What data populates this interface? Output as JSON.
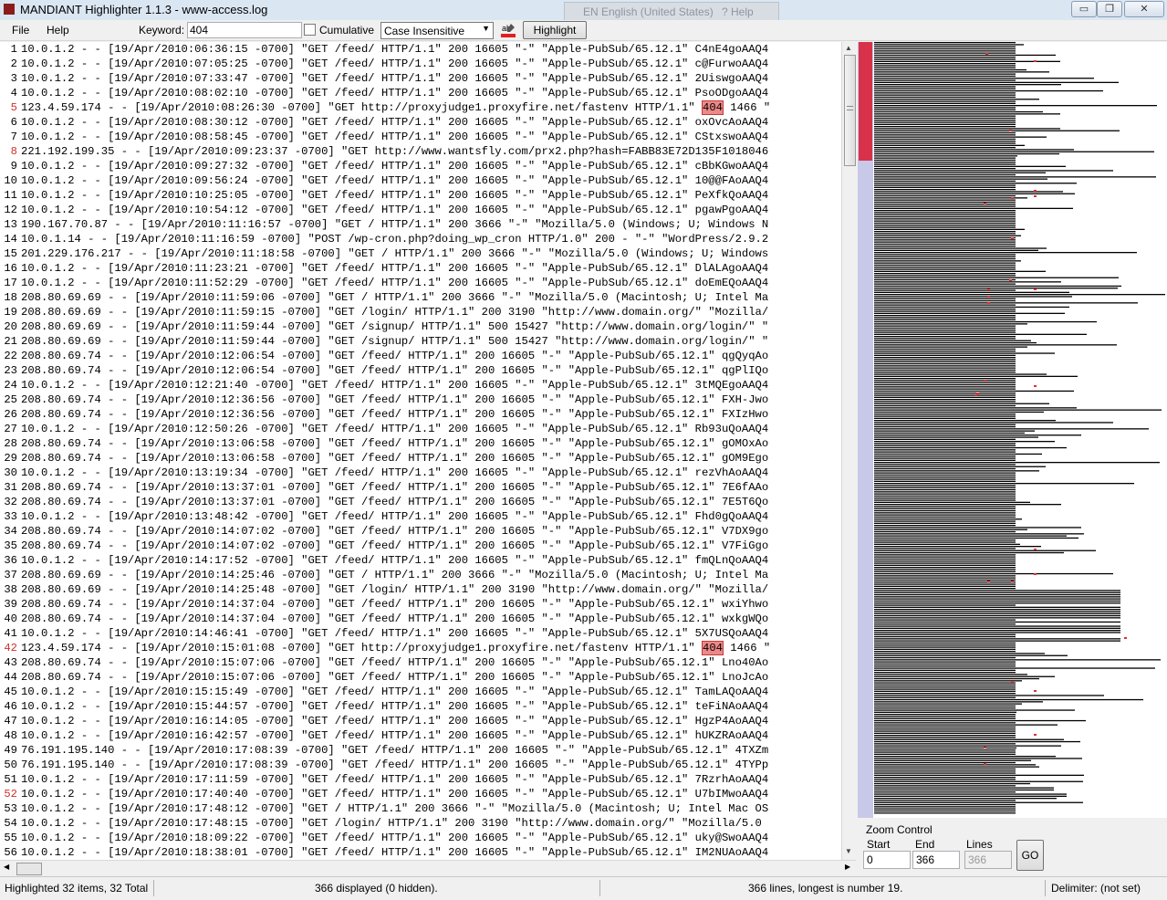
{
  "window": {
    "title": "MANDIANT Highlighter 1.1.3 - www-access.log",
    "min": "▭",
    "max": "❐",
    "close": "✕"
  },
  "ime": {
    "lang": "EN English (United States)",
    "help": "? Help"
  },
  "menu": {
    "file": "File",
    "help": "Help"
  },
  "toolbar": {
    "keyword_label": "Keyword:",
    "keyword_value": "404",
    "cumulative_label": "Cumulative",
    "case_value": "Case Insensitive",
    "highlight_label": "Highlight"
  },
  "log": {
    "keyword": "404",
    "lines": [
      "10.0.1.2 - - [19/Apr/2010:06:36:15 -0700] \"GET /feed/ HTTP/1.1\" 200 16605 \"-\" \"Apple-PubSub/65.12.1\" C4nE4goAAQ4",
      "10.0.1.2 - - [19/Apr/2010:07:05:25 -0700] \"GET /feed/ HTTP/1.1\" 200 16605 \"-\" \"Apple-PubSub/65.12.1\" c@FurwoAAQ4",
      "10.0.1.2 - - [19/Apr/2010:07:33:47 -0700] \"GET /feed/ HTTP/1.1\" 200 16605 \"-\" \"Apple-PubSub/65.12.1\" 2UiswgoAAQ4",
      "10.0.1.2 - - [19/Apr/2010:08:02:10 -0700] \"GET /feed/ HTTP/1.1\" 200 16605 \"-\" \"Apple-PubSub/65.12.1\" PsoODgoAAQ4",
      "123.4.59.174 - - [19/Apr/2010:08:26:30 -0700] \"GET http://proxyjudge1.proxyfire.net/fastenv HTTP/1.1\" 404 1466 \"",
      "10.0.1.2 - - [19/Apr/2010:08:30:12 -0700] \"GET /feed/ HTTP/1.1\" 200 16605 \"-\" \"Apple-PubSub/65.12.1\" oxOvcAoAAQ4",
      "10.0.1.2 - - [19/Apr/2010:08:58:45 -0700] \"GET /feed/ HTTP/1.1\" 200 16605 \"-\" \"Apple-PubSub/65.12.1\" CStxswoAAQ4",
      "221.192.199.35 - - [19/Apr/2010:09:23:37 -0700] \"GET http://www.wantsfly.com/prx2.php?hash=FABB83E72D135F1018046",
      "10.0.1.2 - - [19/Apr/2010:09:27:32 -0700] \"GET /feed/ HTTP/1.1\" 200 16605 \"-\" \"Apple-PubSub/65.12.1\" cBbKGwoAAQ4",
      "10.0.1.2 - - [19/Apr/2010:09:56:24 -0700] \"GET /feed/ HTTP/1.1\" 200 16605 \"-\" \"Apple-PubSub/65.12.1\" 10@@FAoAAQ4",
      "10.0.1.2 - - [19/Apr/2010:10:25:05 -0700] \"GET /feed/ HTTP/1.1\" 200 16605 \"-\" \"Apple-PubSub/65.12.1\" PeXfkQoAAQ4",
      "10.0.1.2 - - [19/Apr/2010:10:54:12 -0700] \"GET /feed/ HTTP/1.1\" 200 16605 \"-\" \"Apple-PubSub/65.12.1\" pgawPgoAAQ4",
      "190.167.70.87 - - [19/Apr/2010:11:16:57 -0700] \"GET / HTTP/1.1\" 200 3666 \"-\" \"Mozilla/5.0 (Windows; U; Windows N",
      "10.0.1.14 - - [19/Apr/2010:11:16:59 -0700] \"POST /wp-cron.php?doing_wp_cron HTTP/1.0\" 200 - \"-\" \"WordPress/2.9.2",
      "201.229.176.217 - - [19/Apr/2010:11:18:58 -0700] \"GET / HTTP/1.1\" 200 3666 \"-\" \"Mozilla/5.0 (Windows; U; Windows",
      "10.0.1.2 - - [19/Apr/2010:11:23:21 -0700] \"GET /feed/ HTTP/1.1\" 200 16605 \"-\" \"Apple-PubSub/65.12.1\" DlALAgoAAQ4",
      "10.0.1.2 - - [19/Apr/2010:11:52:29 -0700] \"GET /feed/ HTTP/1.1\" 200 16605 \"-\" \"Apple-PubSub/65.12.1\" doEmEQoAAQ4",
      "208.80.69.69 - - [19/Apr/2010:11:59:06 -0700] \"GET / HTTP/1.1\" 200 3666 \"-\" \"Mozilla/5.0 (Macintosh; U; Intel Ma",
      "208.80.69.69 - - [19/Apr/2010:11:59:15 -0700] \"GET /login/ HTTP/1.1\" 200 3190 \"http://www.domain.org/\" \"Mozilla/",
      "208.80.69.69 - - [19/Apr/2010:11:59:44 -0700] \"GET /signup/ HTTP/1.1\" 500 15427 \"http://www.domain.org/login/\" \"",
      "208.80.69.69 - - [19/Apr/2010:11:59:44 -0700] \"GET /signup/ HTTP/1.1\" 500 15427 \"http://www.domain.org/login/\" \"",
      "208.80.69.74 - - [19/Apr/2010:12:06:54 -0700] \"GET /feed/ HTTP/1.1\" 200 16605 \"-\" \"Apple-PubSub/65.12.1\" qgQyqAo",
      "208.80.69.74 - - [19/Apr/2010:12:06:54 -0700] \"GET /feed/ HTTP/1.1\" 200 16605 \"-\" \"Apple-PubSub/65.12.1\" qgPlIQo",
      "10.0.1.2 - - [19/Apr/2010:12:21:40 -0700] \"GET /feed/ HTTP/1.1\" 200 16605 \"-\" \"Apple-PubSub/65.12.1\" 3tMQEgoAAQ4",
      "208.80.69.74 - - [19/Apr/2010:12:36:56 -0700] \"GET /feed/ HTTP/1.1\" 200 16605 \"-\" \"Apple-PubSub/65.12.1\" FXH-Jwo",
      "208.80.69.74 - - [19/Apr/2010:12:36:56 -0700] \"GET /feed/ HTTP/1.1\" 200 16605 \"-\" \"Apple-PubSub/65.12.1\" FXIzHwo",
      "10.0.1.2 - - [19/Apr/2010:12:50:26 -0700] \"GET /feed/ HTTP/1.1\" 200 16605 \"-\" \"Apple-PubSub/65.12.1\" Rb93uQoAAQ4",
      "208.80.69.74 - - [19/Apr/2010:13:06:58 -0700] \"GET /feed/ HTTP/1.1\" 200 16605 \"-\" \"Apple-PubSub/65.12.1\" gOMOxAo",
      "208.80.69.74 - - [19/Apr/2010:13:06:58 -0700] \"GET /feed/ HTTP/1.1\" 200 16605 \"-\" \"Apple-PubSub/65.12.1\" gOM9Ego",
      "10.0.1.2 - - [19/Apr/2010:13:19:34 -0700] \"GET /feed/ HTTP/1.1\" 200 16605 \"-\" \"Apple-PubSub/65.12.1\" rezVhAoAAQ4",
      "208.80.69.74 - - [19/Apr/2010:13:37:01 -0700] \"GET /feed/ HTTP/1.1\" 200 16605 \"-\" \"Apple-PubSub/65.12.1\" 7E6fAAo",
      "208.80.69.74 - - [19/Apr/2010:13:37:01 -0700] \"GET /feed/ HTTP/1.1\" 200 16605 \"-\" \"Apple-PubSub/65.12.1\" 7E5T6Qo",
      "10.0.1.2 - - [19/Apr/2010:13:48:42 -0700] \"GET /feed/ HTTP/1.1\" 200 16605 \"-\" \"Apple-PubSub/65.12.1\" Fhd0gQoAAQ4",
      "208.80.69.74 - - [19/Apr/2010:14:07:02 -0700] \"GET /feed/ HTTP/1.1\" 200 16605 \"-\" \"Apple-PubSub/65.12.1\" V7DX9go",
      "208.80.69.74 - - [19/Apr/2010:14:07:02 -0700] \"GET /feed/ HTTP/1.1\" 200 16605 \"-\" \"Apple-PubSub/65.12.1\" V7FiGgo",
      "10.0.1.2 - - [19/Apr/2010:14:17:52 -0700] \"GET /feed/ HTTP/1.1\" 200 16605 \"-\" \"Apple-PubSub/65.12.1\" fmQLnQoAAQ4",
      "208.80.69.69 - - [19/Apr/2010:14:25:46 -0700] \"GET / HTTP/1.1\" 200 3666 \"-\" \"Mozilla/5.0 (Macintosh; U; Intel Ma",
      "208.80.69.69 - - [19/Apr/2010:14:25:48 -0700] \"GET /login/ HTTP/1.1\" 200 3190 \"http://www.domain.org/\" \"Mozilla/",
      "208.80.69.74 - - [19/Apr/2010:14:37:04 -0700] \"GET /feed/ HTTP/1.1\" 200 16605 \"-\" \"Apple-PubSub/65.12.1\" wxiYhwo",
      "208.80.69.74 - - [19/Apr/2010:14:37:04 -0700] \"GET /feed/ HTTP/1.1\" 200 16605 \"-\" \"Apple-PubSub/65.12.1\" wxkgWQo",
      "10.0.1.2 - - [19/Apr/2010:14:46:41 -0700] \"GET /feed/ HTTP/1.1\" 200 16605 \"-\" \"Apple-PubSub/65.12.1\" 5X7USQoAAQ4",
      "123.4.59.174 - - [19/Apr/2010:15:01:08 -0700] \"GET http://proxyjudge1.proxyfire.net/fastenv HTTP/1.1\" 404 1466 \"",
      "208.80.69.74 - - [19/Apr/2010:15:07:06 -0700] \"GET /feed/ HTTP/1.1\" 200 16605 \"-\" \"Apple-PubSub/65.12.1\" Lno40Ao",
      "208.80.69.74 - - [19/Apr/2010:15:07:06 -0700] \"GET /feed/ HTTP/1.1\" 200 16605 \"-\" \"Apple-PubSub/65.12.1\" LnoJcAo",
      "10.0.1.2 - - [19/Apr/2010:15:15:49 -0700] \"GET /feed/ HTTP/1.1\" 200 16605 \"-\" \"Apple-PubSub/65.12.1\" TamLAQoAAQ4",
      "10.0.1.2 - - [19/Apr/2010:15:44:57 -0700] \"GET /feed/ HTTP/1.1\" 200 16605 \"-\" \"Apple-PubSub/65.12.1\" teFiNAoAAQ4",
      "10.0.1.2 - - [19/Apr/2010:16:14:05 -0700] \"GET /feed/ HTTP/1.1\" 200 16605 \"-\" \"Apple-PubSub/65.12.1\" HgzP4AoAAQ4",
      "10.0.1.2 - - [19/Apr/2010:16:42:57 -0700] \"GET /feed/ HTTP/1.1\" 200 16605 \"-\" \"Apple-PubSub/65.12.1\" hUKZRAoAAQ4",
      "76.191.195.140 - - [19/Apr/2010:17:08:39 -0700] \"GET /feed/ HTTP/1.1\" 200 16605 \"-\" \"Apple-PubSub/65.12.1\" 4TXZm",
      "76.191.195.140 - - [19/Apr/2010:17:08:39 -0700] \"GET /feed/ HTTP/1.1\" 200 16605 \"-\" \"Apple-PubSub/65.12.1\" 4TYPp",
      "10.0.1.2 - - [19/Apr/2010:17:11:59 -0700] \"GET /feed/ HTTP/1.1\" 200 16605 \"-\" \"Apple-PubSub/65.12.1\" 7RzrhAoAAQ4",
      "10.0.1.2 - - [19/Apr/2010:17:40:40 -0700] \"GET /feed/ HTTP/1.1\" 200 16605 \"-\" \"Apple-PubSub/65.12.1\" U7bIMwoAAQ4",
      "10.0.1.2 - - [19/Apr/2010:17:48:12 -0700] \"GET / HTTP/1.1\" 200 3666 \"-\" \"Mozilla/5.0 (Macintosh; U; Intel Mac OS",
      "10.0.1.2 - - [19/Apr/2010:17:48:15 -0700] \"GET /login/ HTTP/1.1\" 200 3190 \"http://www.domain.org/\" \"Mozilla/5.0",
      "10.0.1.2 - - [19/Apr/2010:18:09:22 -0700] \"GET /feed/ HTTP/1.1\" 200 16605 \"-\" \"Apple-PubSub/65.12.1\" uky@SwoAAQ4",
      "10.0.1.2 - - [19/Apr/2010:18:38:01 -0700] \"GET /feed/ HTTP/1.1\" 200 16605 \"-\" \"Apple-PubSub/65.12.1\" IM2NUAoAAQ4"
    ],
    "red_line_numbers": [
      5,
      8,
      42,
      52
    ]
  },
  "zoom": {
    "title": "Zoom Control",
    "start_label": "Start",
    "end_label": "End",
    "lines_label": "Lines",
    "start_value": "0",
    "end_value": "366",
    "lines_value": "366",
    "go_label": "GO"
  },
  "status": {
    "highlighted": "Highlighted 32 items, 32 Total",
    "displayed": "366 displayed (0 hidden).",
    "longest": "366 lines, longest is number 19.",
    "delimiter": "Delimiter: (not set)"
  },
  "colors": {
    "highlight": "#ee8888",
    "overview_thumb": "#d8324a",
    "overview_track": "#c8c8e8"
  }
}
